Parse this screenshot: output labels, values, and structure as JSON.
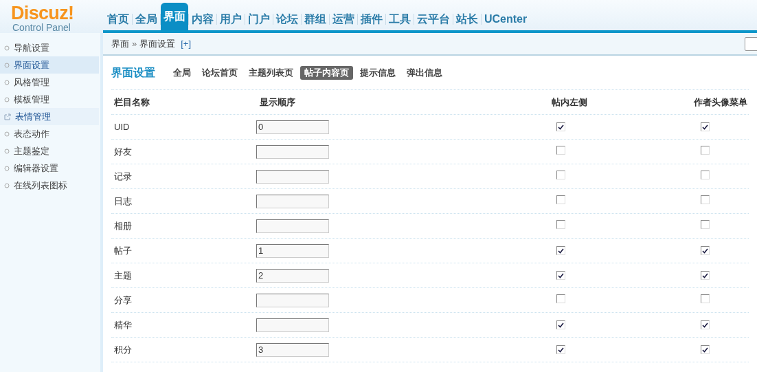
{
  "logo": {
    "brand": "Discuz!",
    "subtitle": "Control Panel"
  },
  "nav": [
    {
      "label": "首页",
      "selected": false
    },
    {
      "label": "全局",
      "selected": false
    },
    {
      "label": "界面",
      "selected": true
    },
    {
      "label": "内容",
      "selected": false
    },
    {
      "label": "用户",
      "selected": false
    },
    {
      "label": "门户",
      "selected": false
    },
    {
      "label": "论坛",
      "selected": false
    },
    {
      "label": "群组",
      "selected": false
    },
    {
      "label": "运营",
      "selected": false
    },
    {
      "label": "插件",
      "selected": false
    },
    {
      "label": "工具",
      "selected": false
    },
    {
      "label": "云平台",
      "selected": false
    },
    {
      "label": "站长",
      "selected": false
    },
    {
      "label": "UCenter",
      "selected": false
    }
  ],
  "breadcrumb": {
    "parent": "界面",
    "separator": "»",
    "current": "界面设置",
    "add": "[+]"
  },
  "sidebar": [
    {
      "label": "导航设置",
      "selected": false,
      "kind": "item"
    },
    {
      "label": "界面设置",
      "selected": true,
      "kind": "item"
    },
    {
      "label": "风格管理",
      "selected": false,
      "kind": "item"
    },
    {
      "label": "模板管理",
      "selected": false,
      "kind": "item"
    },
    {
      "label": "表情管理",
      "selected": false,
      "kind": "external"
    },
    {
      "label": "表态动作",
      "selected": false,
      "kind": "item"
    },
    {
      "label": "主题鉴定",
      "selected": false,
      "kind": "item"
    },
    {
      "label": "编辑器设置",
      "selected": false,
      "kind": "item"
    },
    {
      "label": "在线列表图标",
      "selected": false,
      "kind": "item"
    }
  ],
  "page_title": "界面设置",
  "tabs": [
    {
      "label": "全局",
      "selected": false
    },
    {
      "label": "论坛首页",
      "selected": false
    },
    {
      "label": "主题列表页",
      "selected": false
    },
    {
      "label": "帖子内容页",
      "selected": true
    },
    {
      "label": "提示信息",
      "selected": false
    },
    {
      "label": "弹出信息",
      "selected": false
    }
  ],
  "table": {
    "columns": [
      "栏目名称",
      "显示顺序",
      "帖内左侧",
      "作者头像菜单"
    ],
    "rows": [
      {
        "name": "UID",
        "order": "0",
        "left": true,
        "menu": true
      },
      {
        "name": "好友",
        "order": "",
        "left": false,
        "menu": false
      },
      {
        "name": "记录",
        "order": "",
        "left": false,
        "menu": false
      },
      {
        "name": "日志",
        "order": "",
        "left": false,
        "menu": false
      },
      {
        "name": "相册",
        "order": "",
        "left": false,
        "menu": false
      },
      {
        "name": "帖子",
        "order": "1",
        "left": true,
        "menu": true
      },
      {
        "name": "主题",
        "order": "2",
        "left": true,
        "menu": true
      },
      {
        "name": "分享",
        "order": "",
        "left": false,
        "menu": false
      },
      {
        "name": "精华",
        "order": "",
        "left": true,
        "menu": true
      },
      {
        "name": "积分",
        "order": "3",
        "left": true,
        "menu": true
      }
    ]
  }
}
